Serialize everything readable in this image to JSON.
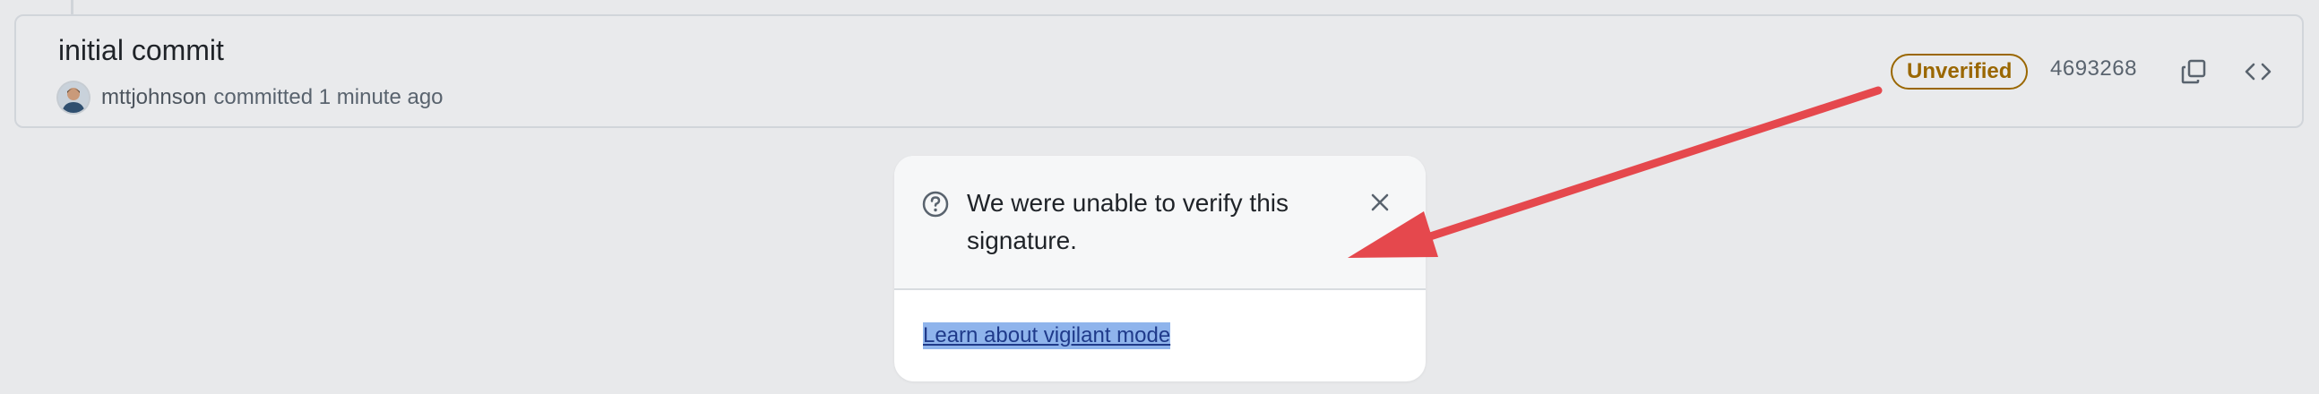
{
  "commit": {
    "title": "initial commit",
    "author": "mttjohnson",
    "committed_text": "committed 1 minute ago",
    "badge": "Unverified",
    "sha": "4693268"
  },
  "icons": {
    "copy": "copy-icon",
    "code": "code-brackets-icon",
    "help": "question-circle-icon",
    "close": "close-icon",
    "avatar": "user-avatar"
  },
  "popover": {
    "message": "We were unable to verify this signature.",
    "link": "Learn about vigilant mode"
  },
  "colors": {
    "badge": "#9a6700",
    "annotation_arrow": "#e5484d",
    "link_highlight": "#8fb4ec"
  }
}
